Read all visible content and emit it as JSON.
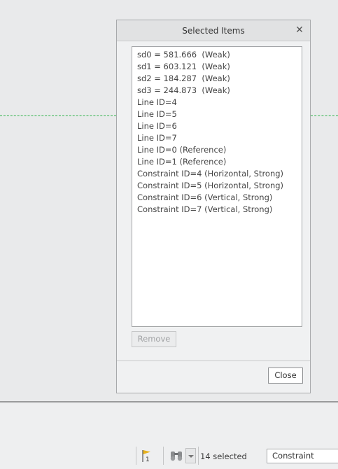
{
  "dialog": {
    "title": "Selected Items",
    "items": [
      "sd0 = 581.666  (Weak)",
      "sd1 = 603.121  (Weak)",
      "sd2 = 184.287  (Weak)",
      "sd3 = 244.873  (Weak)",
      "Line ID=4",
      "Line ID=5",
      "Line ID=6",
      "Line ID=7",
      "Line ID=0 (Reference)",
      "Line ID=1 (Reference)",
      "Constraint ID=4 (Horizontal, Strong)",
      "Constraint ID=5 (Horizontal, Strong)",
      "Constraint ID=6 (Vertical, Strong)",
      "Constraint ID=7 (Vertical, Strong)"
    ],
    "remove_label": "Remove",
    "close_label": "Close"
  },
  "status_bar": {
    "flag_count": "1",
    "selected_count": "14 selected",
    "filter_value": "Constraint"
  },
  "colors": {
    "dash_line": "#2fb24a",
    "flag": "#e8b21c"
  },
  "icons": {
    "close": "close-icon",
    "flag": "flag-icon",
    "find": "binoculars-icon"
  }
}
